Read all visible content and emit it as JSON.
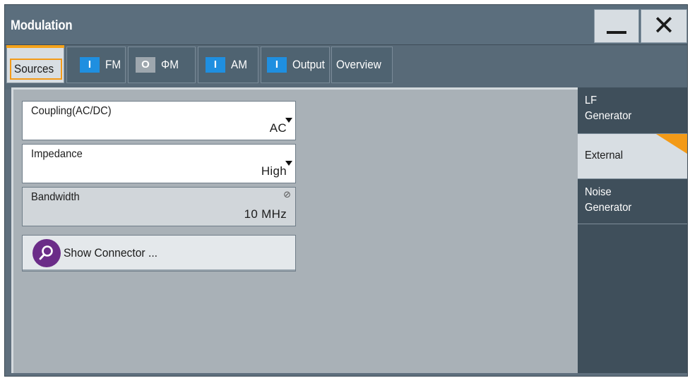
{
  "window": {
    "title": "Modulation",
    "minimize_icon": "minimize-icon",
    "close_icon": "close-icon",
    "close_glyph": "✕"
  },
  "tabs": [
    {
      "label": "Sources",
      "indicator": "",
      "active": true
    },
    {
      "label": "FM",
      "indicator": "I",
      "state": "on"
    },
    {
      "label": "ΦM",
      "indicator": "O",
      "state": "off"
    },
    {
      "label": "AM",
      "indicator": "I",
      "state": "on"
    },
    {
      "label": "Output",
      "indicator": "I",
      "state": "on"
    },
    {
      "label": "Overview",
      "indicator": ""
    }
  ],
  "fields": {
    "coupling": {
      "label": "Coupling(AC/DC)",
      "value": "AC"
    },
    "impedance": {
      "label": "Impedance",
      "value": "High"
    },
    "bandwidth": {
      "label": "Bandwidth",
      "value": "10 MHz"
    }
  },
  "show_connector": {
    "label": "Show Connector ..."
  },
  "side_nav": [
    {
      "line1": "LF",
      "line2": "Generator"
    },
    {
      "line1": "External",
      "line2": "",
      "active": true
    },
    {
      "line1": "Noise",
      "line2": "Generator"
    }
  ],
  "colors": {
    "accent": "#f39a17",
    "indicator_on": "#1f8fe0",
    "indicator_off": "#9ea7ae",
    "search_button": "#6b2c88"
  }
}
